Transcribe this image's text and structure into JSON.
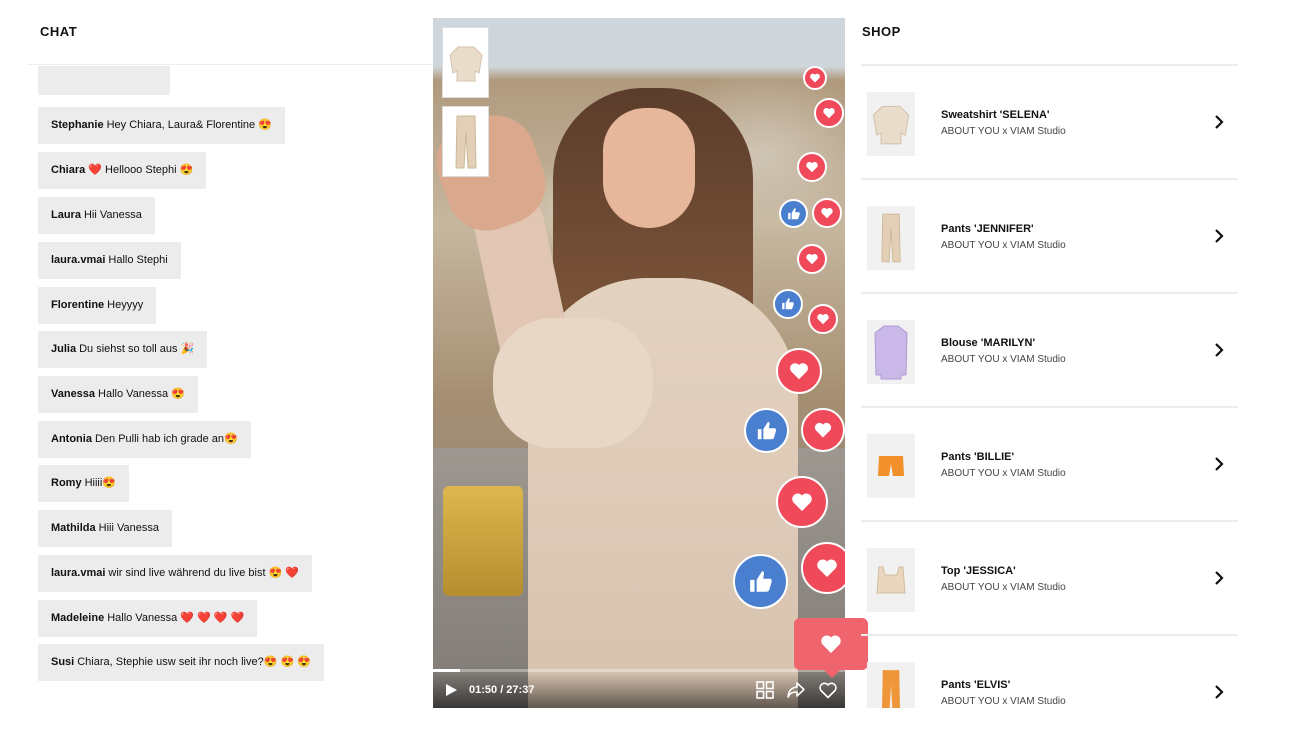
{
  "chat": {
    "title": "CHAT",
    "messages": [
      {
        "user": "Stephanie",
        "text": "Hey Chiara, Laura& Florentine 😍"
      },
      {
        "user": "Chiara",
        "text": "❤️ Hellooo Stephi 😍"
      },
      {
        "user": "Laura",
        "text": "Hii Vanessa"
      },
      {
        "user": "laura.vmai",
        "text": "Hallo Stephi"
      },
      {
        "user": "Florentine",
        "text": "Heyyyy"
      },
      {
        "user": "Julia",
        "text": "Du siehst so toll aus 🎉"
      },
      {
        "user": "Vanessa",
        "text": "Hallo Vanessa 😍"
      },
      {
        "user": "Antonia",
        "text": "Den Pulli hab ich grade an😍"
      },
      {
        "user": "Romy",
        "text": "Hiiii😍"
      },
      {
        "user": "Mathilda",
        "text": "Hiii Vanessa"
      },
      {
        "user": "laura.vmai",
        "text": "wir sind live während du live bist 😍 ❤️"
      },
      {
        "user": "Madeleine",
        "text": "Hallo Vanessa ❤️ ❤️ ❤️ ❤️"
      },
      {
        "user": "Susi",
        "text": "Chiara, Stephie usw seit ihr noch live?😍 😍 😍"
      }
    ]
  },
  "video": {
    "time": "01:50 / 27:37",
    "progress": 0.066,
    "colors": {
      "heart": "#f04a5a",
      "like": "#4a7fd0",
      "popup": "#f0646e"
    }
  },
  "shop": {
    "title": "SHOP",
    "items": [
      {
        "name": "Sweatshirt 'SELENA'",
        "brand": "ABOUT YOU x VIAM Studio",
        "color": "#eadccb"
      },
      {
        "name": "Pants 'JENNIFER'",
        "brand": "ABOUT YOU x VIAM Studio",
        "color": "#e2cfb6"
      },
      {
        "name": "Blouse 'MARILYN'",
        "brand": "ABOUT YOU x VIAM Studio",
        "color": "#c9b8e8"
      },
      {
        "name": "Pants 'BILLIE'",
        "brand": "ABOUT YOU x VIAM Studio",
        "color": "#f2902b"
      },
      {
        "name": "Top 'JESSICA'",
        "brand": "ABOUT YOU x VIAM Studio",
        "color": "#e8d6bf"
      },
      {
        "name": "Pants 'ELVIS'",
        "brand": "ABOUT YOU x VIAM Studio",
        "color": "#f0963a"
      }
    ]
  }
}
